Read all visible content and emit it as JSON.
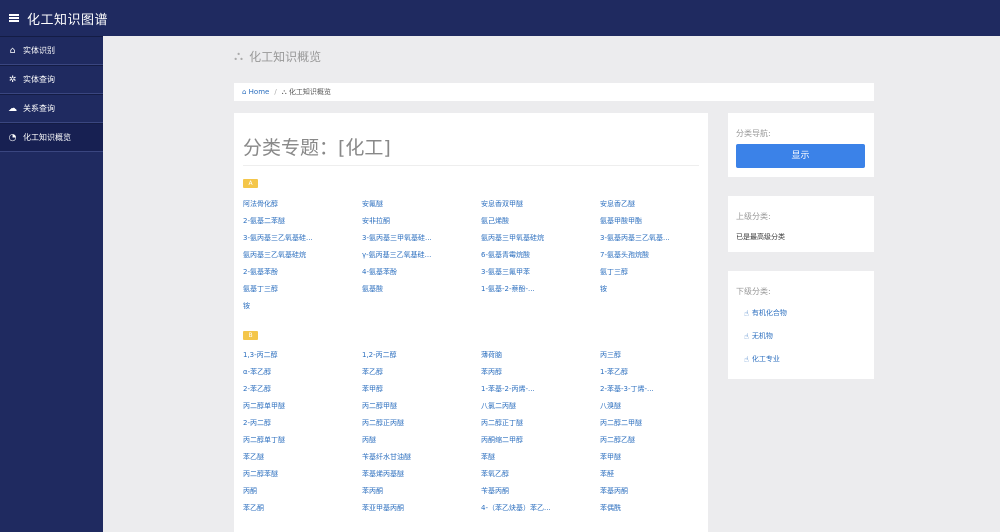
{
  "app": {
    "title": "化工知识图谱"
  },
  "sidebar": {
    "items": [
      {
        "label": "实体识别",
        "icon": "home-icon"
      },
      {
        "label": "实体查询",
        "icon": "gear-icon"
      },
      {
        "label": "关系查询",
        "icon": "cloud-icon"
      },
      {
        "label": "化工知识概览",
        "icon": "pie-chart-icon"
      }
    ]
  },
  "page": {
    "header": "化工知识概览"
  },
  "breadcrumb": {
    "home": "Home",
    "current": "化工知识概览"
  },
  "main": {
    "title": "分类专题：[化工]",
    "sections": [
      {
        "letter": "A",
        "items": [
          "阿法骨化醇",
          "安氟醚",
          "安息香双甲醚",
          "安息香乙醚",
          "2-氨基二苯醚",
          "安非拉酮",
          "氨己烯酸",
          "氨基甲酸甲酯",
          "3-氨丙基三乙氧基硅...",
          "3-氨丙基三甲氧基硅...",
          "氨丙基三甲氧基硅烷",
          "3-氨基丙基三乙氧基...",
          "氨丙基三乙氧基硅烷",
          "γ-氨丙基三乙氧基硅...",
          "6-氨基青霉烷酸",
          "7-氨基头孢烷酸",
          "2-氨基苯酚",
          "4-氨基苯酚",
          "3-氨基三氟甲苯",
          "氨丁三醇",
          "氨基丁三醇",
          "氨基酸",
          "1-氨基-2-萘酚-...",
          "铵",
          "铵"
        ]
      },
      {
        "letter": "B",
        "items": [
          "1,3-丙二醇",
          "1,2-丙二醇",
          "薄荷脑",
          "丙三醇",
          "α-苯乙醇",
          "苯乙醇",
          "苯丙醇",
          "1-苯乙醇",
          "2-苯乙醇",
          "苯甲醇",
          "1-苯基-2-丙烯-...",
          "2-苯基-3-丁烯-...",
          "丙二醇单甲醚",
          "丙二醇甲醚",
          "八氯二丙醚",
          "八溴醚",
          "2-丙二醇",
          "丙二醇正丙醚",
          "丙二醇正丁醚",
          "丙二醇二甲醚",
          "丙二醇单丁醚",
          "丙醚",
          "丙酮缩二甲醇",
          "丙二醇乙醚",
          "苯乙醚",
          "苄基纤水甘油醚",
          "苯醚",
          "苯甲醚",
          "丙二醇苯醚",
          "苯基烯丙基醚",
          "苯氧乙醇",
          "苯醛",
          "丙酮",
          "苯丙酮",
          "苄基丙酮",
          "苯基丙酮",
          "苯乙酮",
          "苯亚甲基丙酮",
          "4-（苯乙炔基）苯乙...",
          "苯偶酰"
        ]
      }
    ]
  },
  "nav_card": {
    "header": "分类导航:",
    "button": "显示"
  },
  "parent_card": {
    "header": "上级分类:",
    "text": "已是最高级分类"
  },
  "child_card": {
    "header": "下级分类:",
    "items": [
      "有机化合物",
      "无机物",
      "化工专业"
    ]
  },
  "colors": {
    "navy": "#1f2a60",
    "link": "#2c6fbf",
    "badge": "#f4c64a",
    "button": "#3b82e8"
  }
}
